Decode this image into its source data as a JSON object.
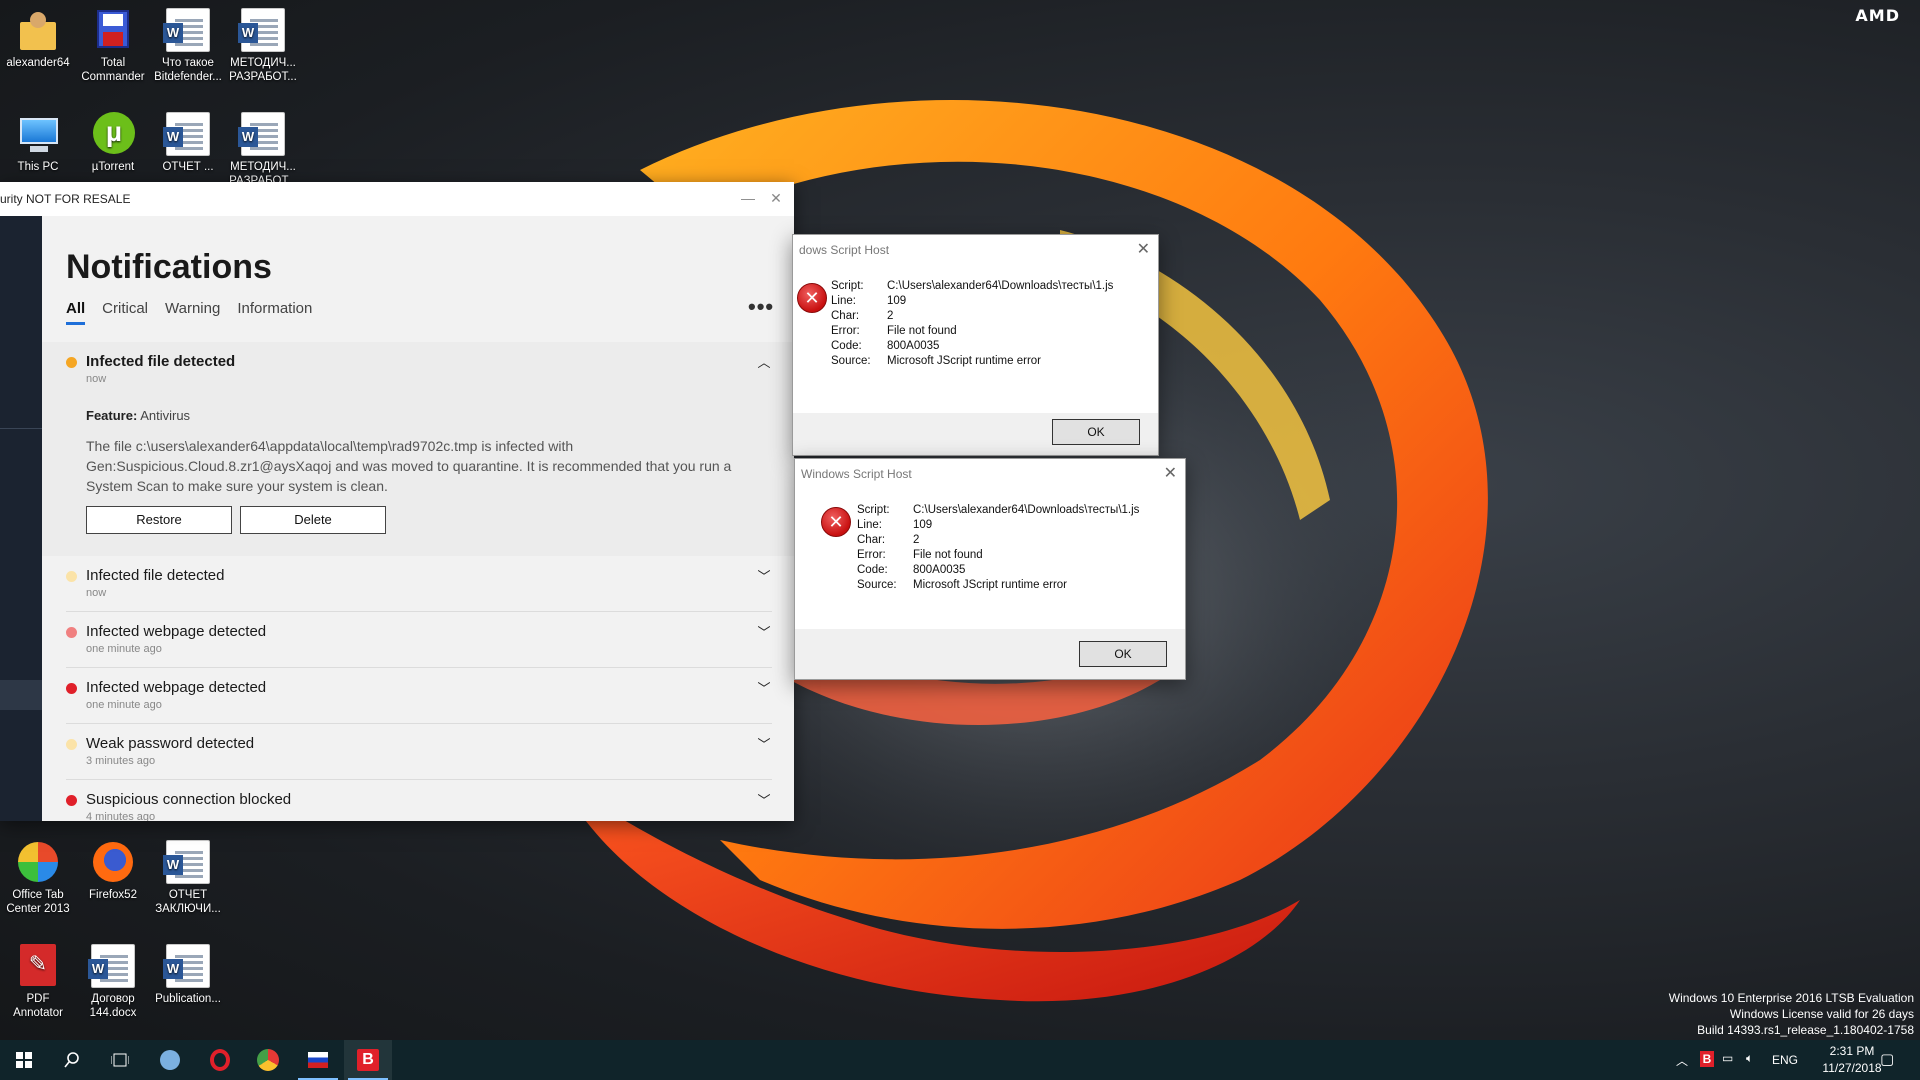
{
  "desktop": {
    "brand_logo": "AMD",
    "icons": [
      {
        "label": "alexander64",
        "icon": "user-folder-icon"
      },
      {
        "label": "Total Commander",
        "icon": "floppy-disk-icon"
      },
      {
        "label": "Что такое Bitdefender...",
        "icon": "word-doc-icon"
      },
      {
        "label": "МЕТОДИЧ... РАЗРАБОТ...",
        "icon": "word-doc-icon"
      },
      {
        "label": "This PC",
        "icon": "computer-icon"
      },
      {
        "label": "µTorrent",
        "icon": "utorrent-icon"
      },
      {
        "label": "ОТЧЕТ ...",
        "icon": "word-doc-icon"
      },
      {
        "label": "МЕТОДИЧ... РАЗРАБОТ...",
        "icon": "word-doc-icon"
      },
      {
        "label": "Office Tab Center 2013",
        "icon": "office-tab-icon"
      },
      {
        "label": "Firefox52",
        "icon": "firefox-icon"
      },
      {
        "label": "ОТЧЕТ ЗАКЛЮЧИ...",
        "icon": "word-doc-icon"
      },
      {
        "label": "PDF Annotator",
        "icon": "pdf-annotator-icon"
      },
      {
        "label": "Договор 144.docx",
        "icon": "word-doc-icon"
      },
      {
        "label": "Publication...",
        "icon": "word-doc-icon"
      }
    ],
    "watermark": [
      "Windows 10 Enterprise 2016 LTSB Evaluation",
      "Windows License valid for 26 days",
      "Build 14393.rs1_release_1.180402-1758"
    ]
  },
  "bitdefender": {
    "window_title": "urity NOT FOR RESALE",
    "page_title": "Notifications",
    "tabs": [
      "All",
      "Critical",
      "Warning",
      "Information"
    ],
    "active_tab": "All",
    "more_label": "•••",
    "expanded": {
      "title": "Infected file detected",
      "time": "now",
      "dot_color": "#f5a623",
      "feature_label": "Feature:",
      "feature_value": "Antivirus",
      "description": "The file c:\\users\\alexander64\\appdata\\local\\temp\\rad9702c.tmp is infected with Gen:Suspicious.Cloud.8.zr1@aysXaqoj and was moved to quarantine. It is recommended that you run a System Scan to make sure your system is clean.",
      "restore_label": "Restore",
      "delete_label": "Delete"
    },
    "items": [
      {
        "title": "Infected file detected",
        "time": "now",
        "dot_color": "#fbe3a8"
      },
      {
        "title": "Infected webpage detected",
        "time": "one minute ago",
        "dot_color": "#f08080"
      },
      {
        "title": "Infected webpage detected",
        "time": "one minute ago",
        "dot_color": "#e0202a"
      },
      {
        "title": "Weak password detected",
        "time": "3 minutes ago",
        "dot_color": "#fbe3a8"
      },
      {
        "title": "Suspicious connection blocked",
        "time": "4 minutes ago",
        "dot_color": "#e0202a"
      }
    ]
  },
  "wsh_dialogs": [
    {
      "title": "dows Script Host",
      "rows": [
        {
          "k": "Script:",
          "v": "C:\\Users\\alexander64\\Downloads\\тесты\\1.js"
        },
        {
          "k": "Line:",
          "v": "109"
        },
        {
          "k": "Char:",
          "v": "2"
        },
        {
          "k": "Error:",
          "v": "File not found"
        },
        {
          "k": "Code:",
          "v": "800A0035"
        },
        {
          "k": "Source:",
          "v": "Microsoft JScript runtime error"
        }
      ],
      "ok_label": "OK"
    },
    {
      "title": "Windows Script Host",
      "rows": [
        {
          "k": "Script:",
          "v": "C:\\Users\\alexander64\\Downloads\\тесты\\1.js"
        },
        {
          "k": "Line:",
          "v": "109"
        },
        {
          "k": "Char:",
          "v": "2"
        },
        {
          "k": "Error:",
          "v": "File not found"
        },
        {
          "k": "Code:",
          "v": "800A0035"
        },
        {
          "k": "Source:",
          "v": "Microsoft JScript runtime error"
        }
      ],
      "ok_label": "OK"
    }
  ],
  "taskbar": {
    "language": "ENG",
    "time": "2:31 PM",
    "date": "11/27/2018",
    "accent": "#10242a"
  }
}
